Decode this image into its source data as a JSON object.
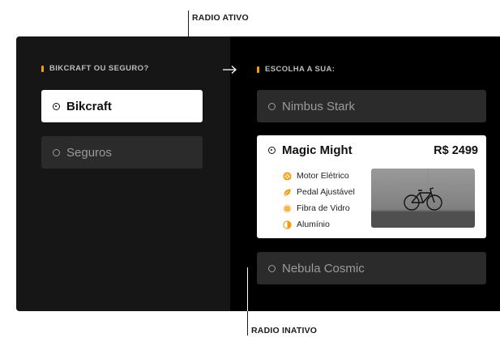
{
  "annotations": {
    "active_label": "RADIO ATIVO",
    "inactive_label": "RADIO INATIVO"
  },
  "left_panel": {
    "title": "BIKCRAFT OU SEGURO?",
    "options": [
      {
        "label": "Bikcraft",
        "selected": true
      },
      {
        "label": "Seguros",
        "selected": false
      }
    ]
  },
  "right_panel": {
    "title": "ESCOLHA A SUA:",
    "options": [
      {
        "label": "Nimbus Stark",
        "selected": false
      },
      {
        "label": "Magic Might",
        "selected": true,
        "price": "R$ 2499"
      },
      {
        "label": "Nebula Cosmic",
        "selected": false
      }
    ],
    "features": [
      {
        "label": "Motor Elétrico",
        "icon": "motor-icon"
      },
      {
        "label": "Pedal Ajustável",
        "icon": "leaf-icon"
      },
      {
        "label": "Fibra de Vidro",
        "icon": "fiber-icon"
      },
      {
        "label": "Alumínio",
        "icon": "half-circle-icon"
      }
    ]
  },
  "colors": {
    "accent": "#f29d0d",
    "panel_left": "#161616",
    "panel_right": "#000000",
    "inactive_option": "#2b2b2b",
    "active_option": "#ffffff"
  }
}
